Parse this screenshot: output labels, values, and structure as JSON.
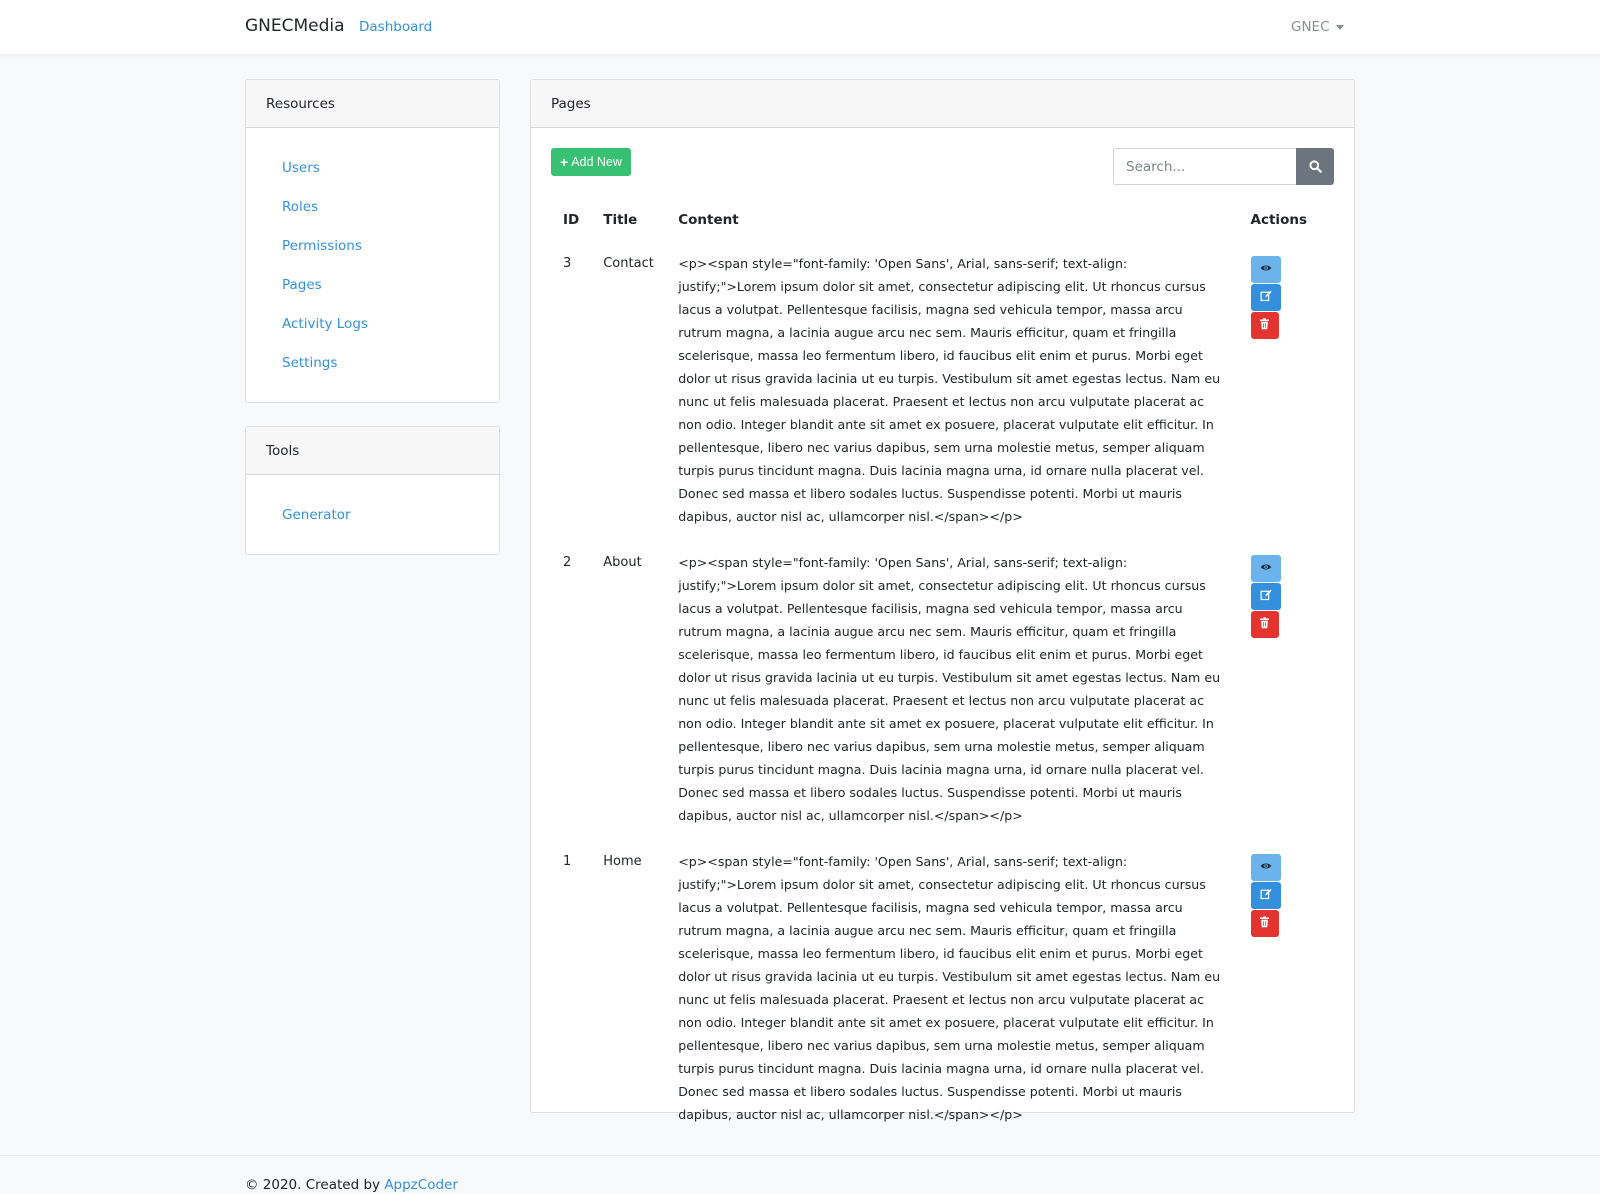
{
  "navbar": {
    "brand": "GNECMedia",
    "dashboard_link": "Dashboard",
    "user_menu": "GNEC"
  },
  "sidebar": {
    "resources": {
      "title": "Resources",
      "items": [
        {
          "label": "Users"
        },
        {
          "label": "Roles"
        },
        {
          "label": "Permissions"
        },
        {
          "label": "Pages"
        },
        {
          "label": "Activity Logs"
        },
        {
          "label": "Settings"
        }
      ]
    },
    "tools": {
      "title": "Tools",
      "items": [
        {
          "label": "Generator"
        }
      ]
    }
  },
  "main": {
    "title": "Pages",
    "add_button": "Add New",
    "search": {
      "placeholder": "Search..."
    },
    "table": {
      "headers": {
        "id": "ID",
        "title": "Title",
        "content": "Content",
        "actions": "Actions"
      },
      "rows": [
        {
          "id": "3",
          "title": "Contact",
          "content": "<p><span style=\"font-family: 'Open Sans', Arial, sans-serif; text-align: justify;\">Lorem ipsum dolor sit amet, consectetur adipiscing elit. Ut rhoncus cursus lacus a volutpat. Pellentesque facilisis, magna sed vehicula tempor, massa arcu rutrum magna, a lacinia augue arcu nec sem. Mauris efficitur, quam et fringilla scelerisque, massa leo fermentum libero, id faucibus elit enim et purus. Morbi eget dolor ut risus gravida lacinia ut eu turpis. Vestibulum sit amet egestas lectus. Nam eu nunc ut felis malesuada placerat. Praesent et lectus non arcu vulputate placerat ac non odio. Integer blandit ante sit amet ex posuere, placerat vulputate elit efficitur. In pellentesque, libero nec varius dapibus, sem urna molestie metus, semper aliquam turpis purus tincidunt magna. Duis lacinia magna urna, id ornare nulla placerat vel. Donec sed massa et libero sodales luctus. Suspendisse potenti. Morbi ut mauris dapibus, auctor nisl ac, ullamcorper nisl.</span></p>"
        },
        {
          "id": "2",
          "title": "About",
          "content": "<p><span style=\"font-family: 'Open Sans', Arial, sans-serif; text-align: justify;\">Lorem ipsum dolor sit amet, consectetur adipiscing elit. Ut rhoncus cursus lacus a volutpat. Pellentesque facilisis, magna sed vehicula tempor, massa arcu rutrum magna, a lacinia augue arcu nec sem. Mauris efficitur, quam et fringilla scelerisque, massa leo fermentum libero, id faucibus elit enim et purus. Morbi eget dolor ut risus gravida lacinia ut eu turpis. Vestibulum sit amet egestas lectus. Nam eu nunc ut felis malesuada placerat. Praesent et lectus non arcu vulputate placerat ac non odio. Integer blandit ante sit amet ex posuere, placerat vulputate elit efficitur. In pellentesque, libero nec varius dapibus, sem urna molestie metus, semper aliquam turpis purus tincidunt magna. Duis lacinia magna urna, id ornare nulla placerat vel. Donec sed massa et libero sodales luctus. Suspendisse potenti. Morbi ut mauris dapibus, auctor nisl ac, ullamcorper nisl.</span></p>"
        },
        {
          "id": "1",
          "title": "Home",
          "content": "<p><span style=\"font-family: 'Open Sans', Arial, sans-serif; text-align: justify;\">Lorem ipsum dolor sit amet, consectetur adipiscing elit. Ut rhoncus cursus lacus a volutpat. Pellentesque facilisis, magna sed vehicula tempor, massa arcu rutrum magna, a lacinia augue arcu nec sem. Mauris efficitur, quam et fringilla scelerisque, massa leo fermentum libero, id faucibus elit enim et purus. Morbi eget dolor ut risus gravida lacinia ut eu turpis. Vestibulum sit amet egestas lectus. Nam eu nunc ut felis malesuada placerat. Praesent et lectus non arcu vulputate placerat ac non odio. Integer blandit ante sit amet ex posuere, placerat vulputate elit efficitur. In pellentesque, libero nec varius dapibus, sem urna molestie metus, semper aliquam turpis purus tincidunt magna. Duis lacinia magna urna, id ornare nulla placerat vel. Donec sed massa et libero sodales luctus. Suspendisse potenti. Morbi ut mauris dapibus, auctor nisl ac, ullamcorper nisl.</span></p>"
        }
      ]
    }
  },
  "footer": {
    "text": "© 2020. Created by",
    "link": "AppzCoder"
  },
  "icons": {
    "view": "eye-icon",
    "edit": "edit-icon",
    "delete": "trash-icon",
    "search": "search-icon",
    "add": "plus-icon"
  },
  "colors": {
    "primary": "#3490dc",
    "info": "#6cb2eb",
    "success": "#38c172",
    "danger": "#e3342f",
    "secondary": "#6c757d"
  }
}
